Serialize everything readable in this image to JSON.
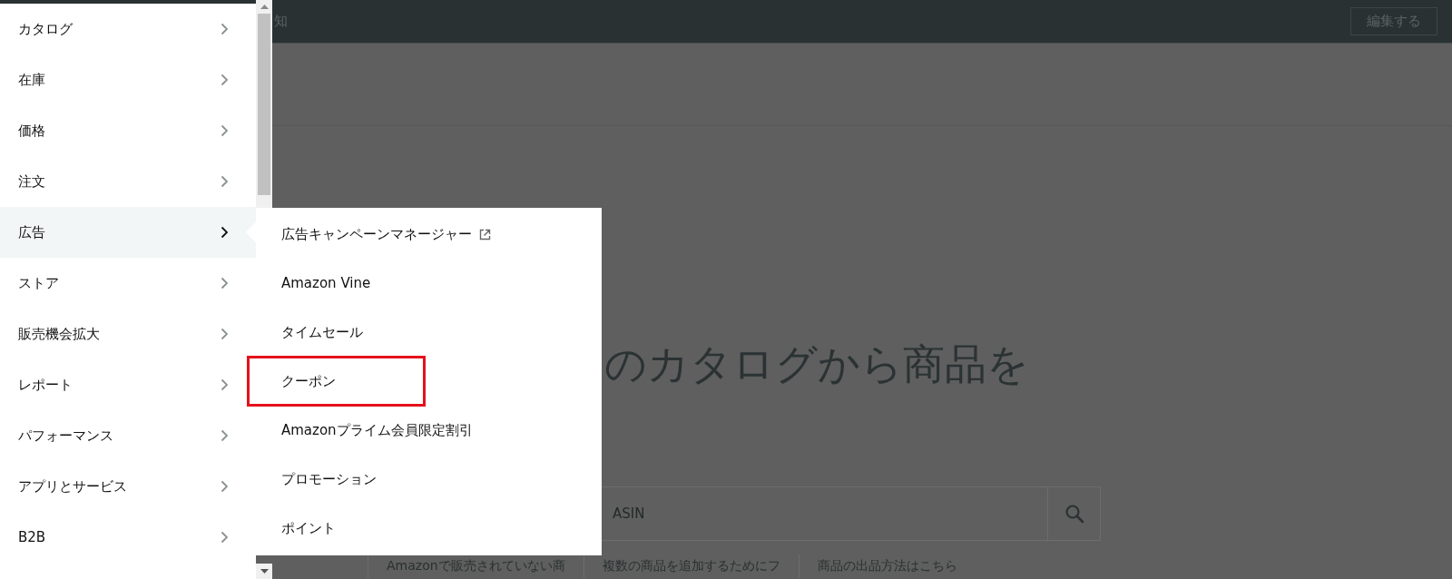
{
  "header": {
    "title": "知",
    "edit_button": "編集する"
  },
  "heading": "のカタログから商品を",
  "search": {
    "placeholder": "ASIN"
  },
  "footer_links": [
    "Amazonで販売されていない商",
    "複数の商品を追加するためにフ",
    "商品の出品方法はこちら"
  ],
  "sidebar": {
    "items": [
      {
        "label": "カタログ",
        "selected": false
      },
      {
        "label": "在庫",
        "selected": false
      },
      {
        "label": "価格",
        "selected": false
      },
      {
        "label": "注文",
        "selected": false
      },
      {
        "label": "広告",
        "selected": true
      },
      {
        "label": "ストア",
        "selected": false
      },
      {
        "label": "販売機会拡大",
        "selected": false
      },
      {
        "label": "レポート",
        "selected": false
      },
      {
        "label": "パフォーマンス",
        "selected": false
      },
      {
        "label": "アプリとサービス",
        "selected": false
      },
      {
        "label": "B2B",
        "selected": false
      }
    ]
  },
  "submenu": {
    "items": [
      {
        "label": "広告キャンペーンマネージャー",
        "external": true,
        "highlighted": false
      },
      {
        "label": "Amazon Vine",
        "external": false,
        "highlighted": false
      },
      {
        "label": "タイムセール",
        "external": false,
        "highlighted": false
      },
      {
        "label": "クーポン",
        "external": false,
        "highlighted": true
      },
      {
        "label": "Amazonプライム会員限定割引",
        "external": false,
        "highlighted": false
      },
      {
        "label": "プロモーション",
        "external": false,
        "highlighted": false
      },
      {
        "label": "ポイント",
        "external": false,
        "highlighted": false
      }
    ]
  }
}
